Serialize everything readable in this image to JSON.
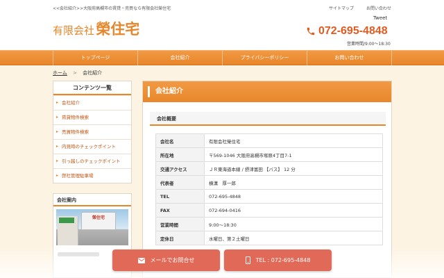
{
  "header": {
    "tagline": "<<会社紹介>>大阪府高槻市の賃貸・売買なら有限会社榮住宅",
    "logo_small": "有限会社",
    "logo_big": "榮住宅",
    "links": [
      {
        "label": "サイトマップ"
      },
      {
        "label": "お問い合わせ"
      }
    ],
    "tweet": "Tweet",
    "phone": "072-695-4848",
    "hours": "営業時間/9:00～18:30"
  },
  "nav": [
    {
      "label": "トップページ"
    },
    {
      "label": "会社紹介"
    },
    {
      "label": "プライバシーポリシー"
    },
    {
      "label": "お問い合わせ"
    }
  ],
  "breadcrumb": {
    "home": "ホーム",
    "separator": ">",
    "current": "会社紹介"
  },
  "sidebar": {
    "title": "コンテンツ一覧",
    "items": [
      {
        "label": "会社紹介"
      },
      {
        "label": "賃貸物件検索"
      },
      {
        "label": "売買物件検索"
      },
      {
        "label": "内見時のチェックポイント"
      },
      {
        "label": "引っ越しのチェックポイント"
      },
      {
        "label": "弊社管理駐車場"
      }
    ],
    "company_title": "会社案内",
    "photo_sign": "榮住宅"
  },
  "main": {
    "title": "会社紹介",
    "section": "会社概要",
    "rows": [
      {
        "key": "会社名",
        "value": "有限会社榮住宅"
      },
      {
        "key": "所在地",
        "value": "〒569-1046 大阪府高槻市塚原4丁目7-1"
      },
      {
        "key": "交通アクセス",
        "value": "ＪＲ東海道本線 / 摂津富田 【バス】 12 分"
      },
      {
        "key": "代表者",
        "value": "横溝　厚一郎"
      },
      {
        "key": "TEL",
        "value": "072-695-4848"
      },
      {
        "key": "FAX",
        "value": "072-694-0416"
      },
      {
        "key": "営業時間",
        "value": "9:00～18:30"
      },
      {
        "key": "定休日",
        "value": "水曜日、第２土曜日"
      }
    ]
  },
  "cta": {
    "mail_label": "メールでお問合せ",
    "tel_label": "TEL : 072-695-4848"
  },
  "colors": {
    "accent": "#e8862a",
    "phone": "#e35a1f",
    "cta": "#e06a57",
    "link": "#c25410"
  }
}
